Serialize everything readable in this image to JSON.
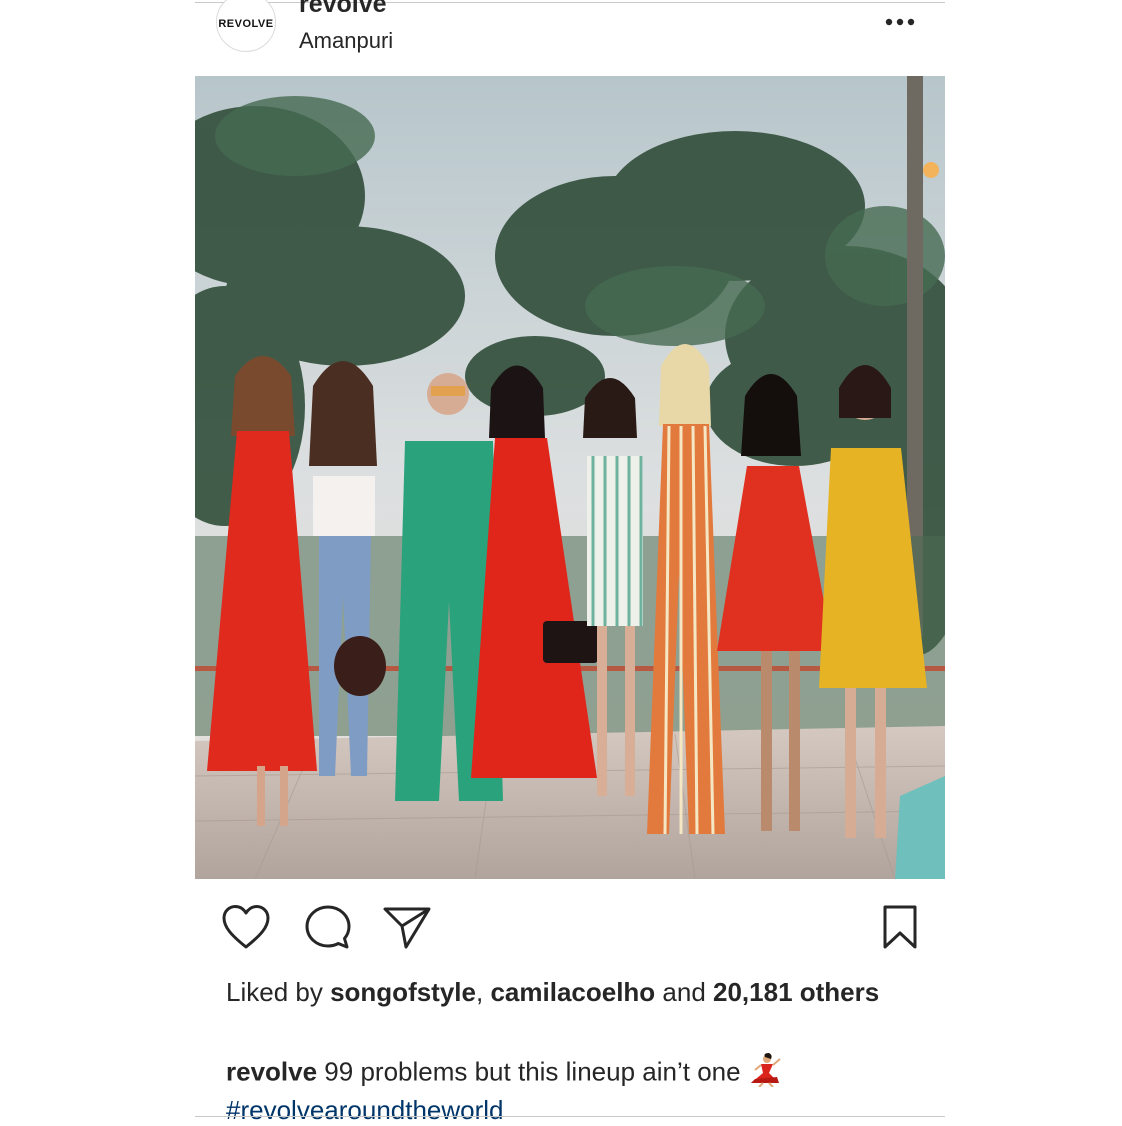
{
  "header": {
    "avatar_text": "REVOLVE",
    "username": "revolve",
    "location": "Amanpuri",
    "more_icon": "more-horizontal-icon"
  },
  "photo": {
    "alt": "Eight women in colorful dresses standing on a terrace in front of tropical trees",
    "colors": {
      "sky": "#d8dcde",
      "trees": "#3f5a46",
      "red_dress": "#e02a1d",
      "green_outfit": "#2aa27c",
      "yellow_dress": "#e6b325",
      "deck": "#c9bdb5"
    }
  },
  "actions": {
    "like_icon": "heart-icon",
    "comment_icon": "comment-bubble-icon",
    "share_icon": "paper-plane-icon",
    "save_icon": "bookmark-icon"
  },
  "likes": {
    "prefix": "Liked by ",
    "user1": "songofstyle",
    "separator": ", ",
    "user2": "camilacoelho",
    "and_text": " and ",
    "others": "20,181 others"
  },
  "caption": {
    "username": "revolve",
    "text": " 99 problems but this lineup ain’t one",
    "emoji": "dancer-emoji",
    "hashtag": "#revolvearoundtheworld"
  },
  "colors": {
    "text": "#262626",
    "hashtag": "#003569",
    "divider": "#c8c8c8"
  }
}
